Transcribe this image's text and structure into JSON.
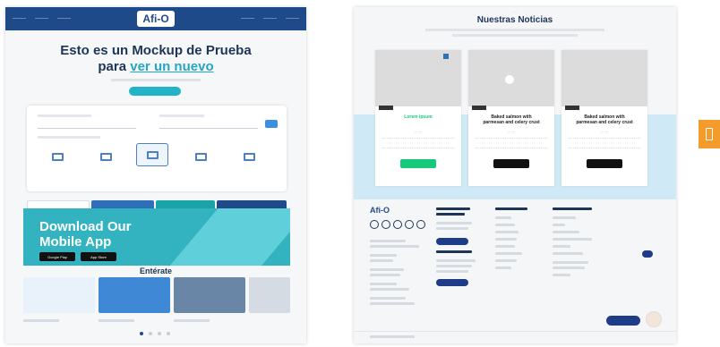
{
  "left": {
    "logo": "Afi-O",
    "hero_line1": "Esto es un Mockup de Prueba",
    "hero_line2_prefix": "para",
    "hero_line2_accent": "ver un nuevo",
    "section_title": "Entérate",
    "app_banner_line1": "Download Our",
    "app_banner_line2": "Mobile App",
    "google_play": "Google Play",
    "app_store": "App Store",
    "colors": {
      "topbar": "#1f4a8a",
      "accent": "#22a7c4",
      "banner": "#33b3bf"
    }
  },
  "right": {
    "section_title": "Nuestras Noticias",
    "logo": "Afi-O",
    "news": [
      {
        "title_line1": "Lorem ipsum",
        "title_line2": "",
        "button_color": "#17c97a"
      },
      {
        "title_line1": "Baked salmon with",
        "title_line2": "parmesan and celery crust",
        "button_color": "#111111"
      },
      {
        "title_line1": "Baked salmon with",
        "title_line2": "parmesan and celery crust",
        "button_color": "#111111"
      }
    ],
    "colors": {
      "band": "#cfeaf6",
      "footer_button": "#1f3c88"
    }
  },
  "side_tab": {
    "icon": "document-icon",
    "color": "#f39c2b"
  }
}
